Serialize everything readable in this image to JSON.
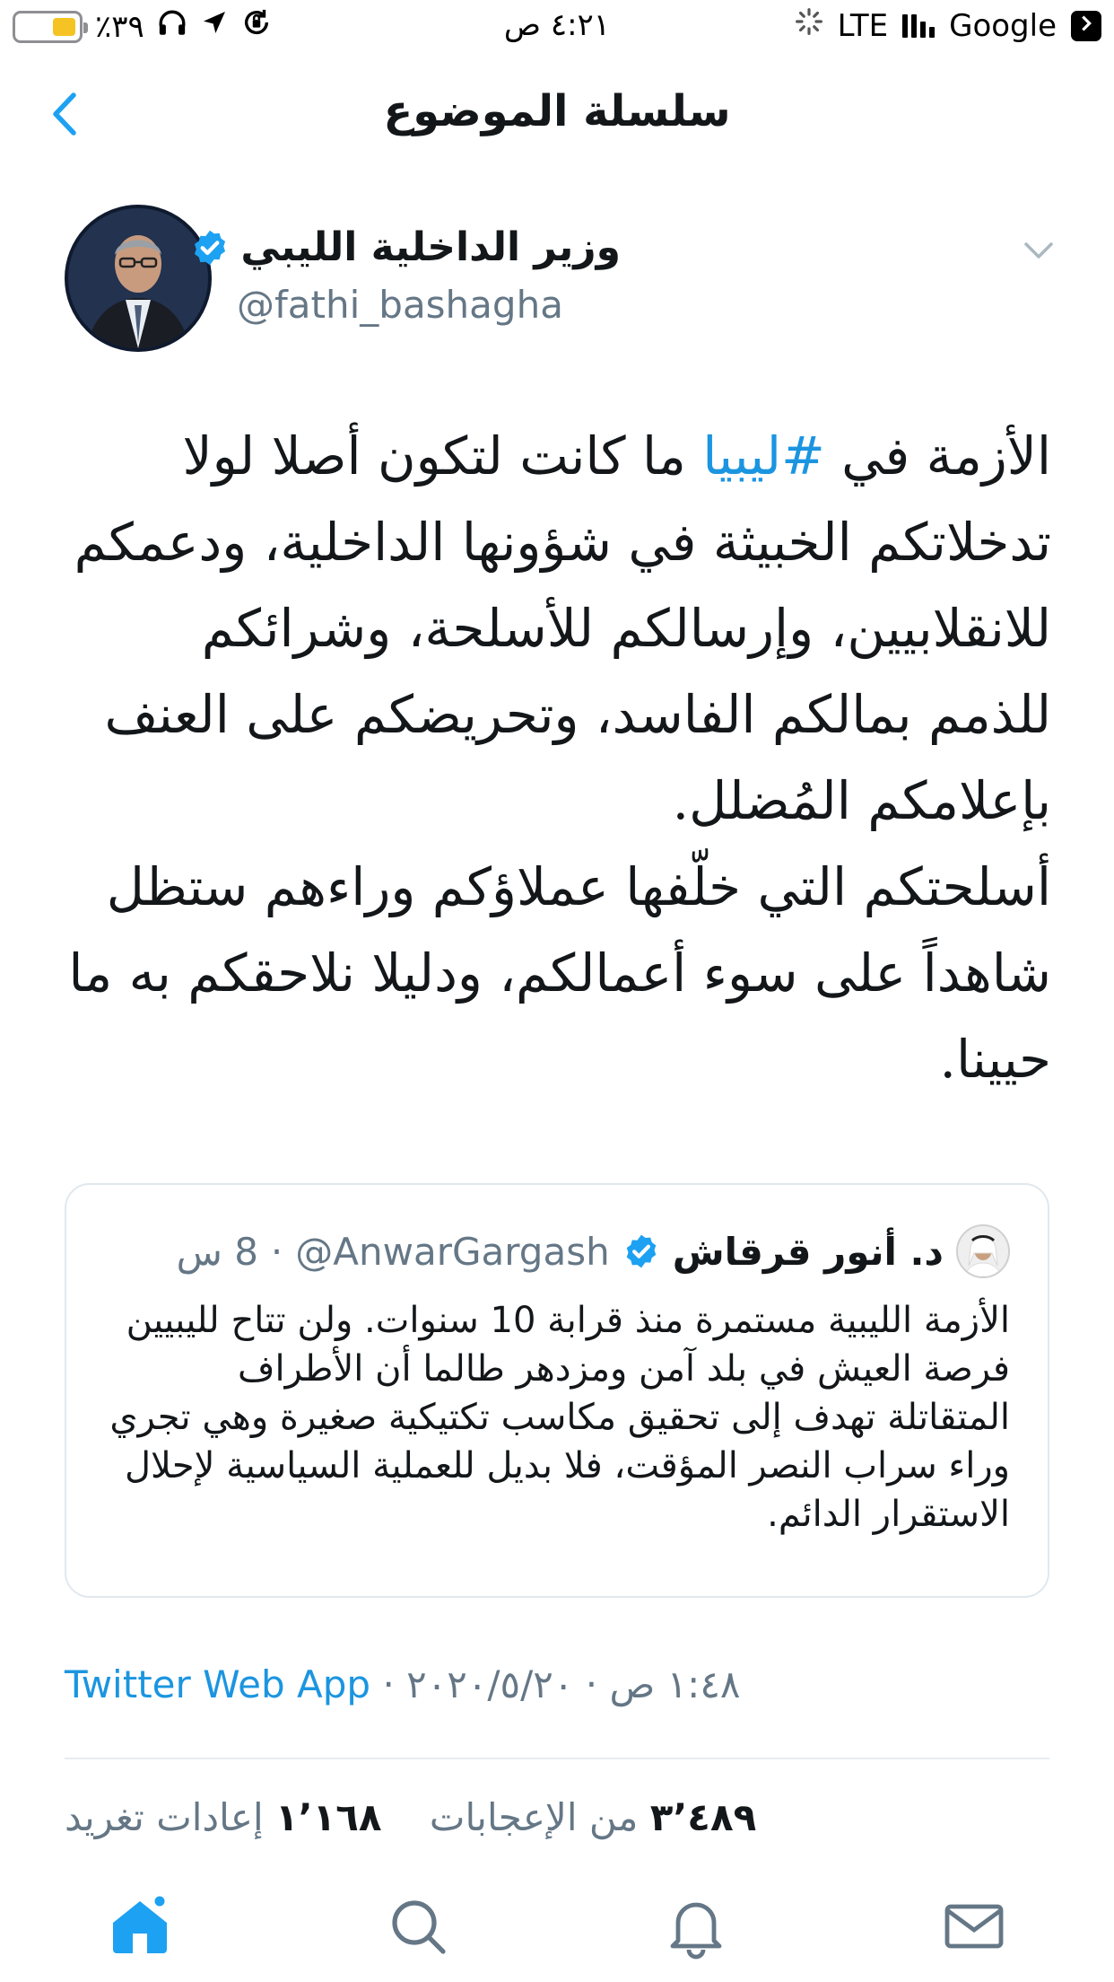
{
  "status_bar": {
    "battery_text": "٪٣٩",
    "battery_level": 0.39,
    "time": "٤:٢١ ص",
    "network": "LTE",
    "carrier": "Google",
    "battery_color": "#f5c323"
  },
  "nav": {
    "title": "سلسلة الموضوع",
    "back_icon": "chevron-left-icon"
  },
  "tweet": {
    "author_name": "وزير الداخلية الليبي",
    "author_handle": "@fathi_bashagha",
    "text_before_hashtag": "الأزمة في ",
    "hashtag": "#ليبيا",
    "text_after_hashtag": " ما كانت لتكون أصلا لولا تدخلاتكم الخبيثة في شؤونها الداخلية، ودعمكم للانقلابيين، وإرسالكم للأسلحة، وشرائكم للذمم بمالكم الفاسد، وتحريضكم على العنف بإعلامكم المُضلل.\nأسلحتكم التي خلّفها عملاؤكم وراءهم ستظل شاهداً على سوء أعمالكم، ودليلا نلاحقكم به ما حيينا."
  },
  "quoted_tweet": {
    "author_name": "د. أنور قرقاش",
    "author_handle": "@AnwarGargash",
    "separator": "·",
    "time": "8 س",
    "text": "الأزمة الليبية مستمرة منذ قرابة 10 سنوات. ولن تتاح لليبيين فرصة العيش في بلد آمن ومزدهر طالما أن الأطراف المتقاتلة تهدف إلى تحقيق مكاسب تكتيكية صغيرة وهي تجري وراء سراب النصر المؤقت، فلا بديل للعملية السياسية لإحلال الاستقرار الدائم."
  },
  "meta": {
    "time": "١:٤٨ ص",
    "date": "٢٠٢٠/٥/٢٠",
    "separator": "·",
    "app": "Twitter Web App"
  },
  "stats": {
    "likes_count": "٣٬٤٨٩",
    "likes_label": "من الإعجابات",
    "retweets_count": "١٬١٦٨",
    "retweets_label": "إعادات تغريد"
  },
  "tabbar": {
    "items": [
      "home-icon",
      "search-icon",
      "notifications-icon",
      "messages-icon"
    ],
    "active_color": "#1da1f2",
    "inactive_color": "#657786"
  },
  "colors": {
    "accent": "#1da1f2",
    "link": "#1b95e0",
    "secondary_text": "#657786"
  }
}
